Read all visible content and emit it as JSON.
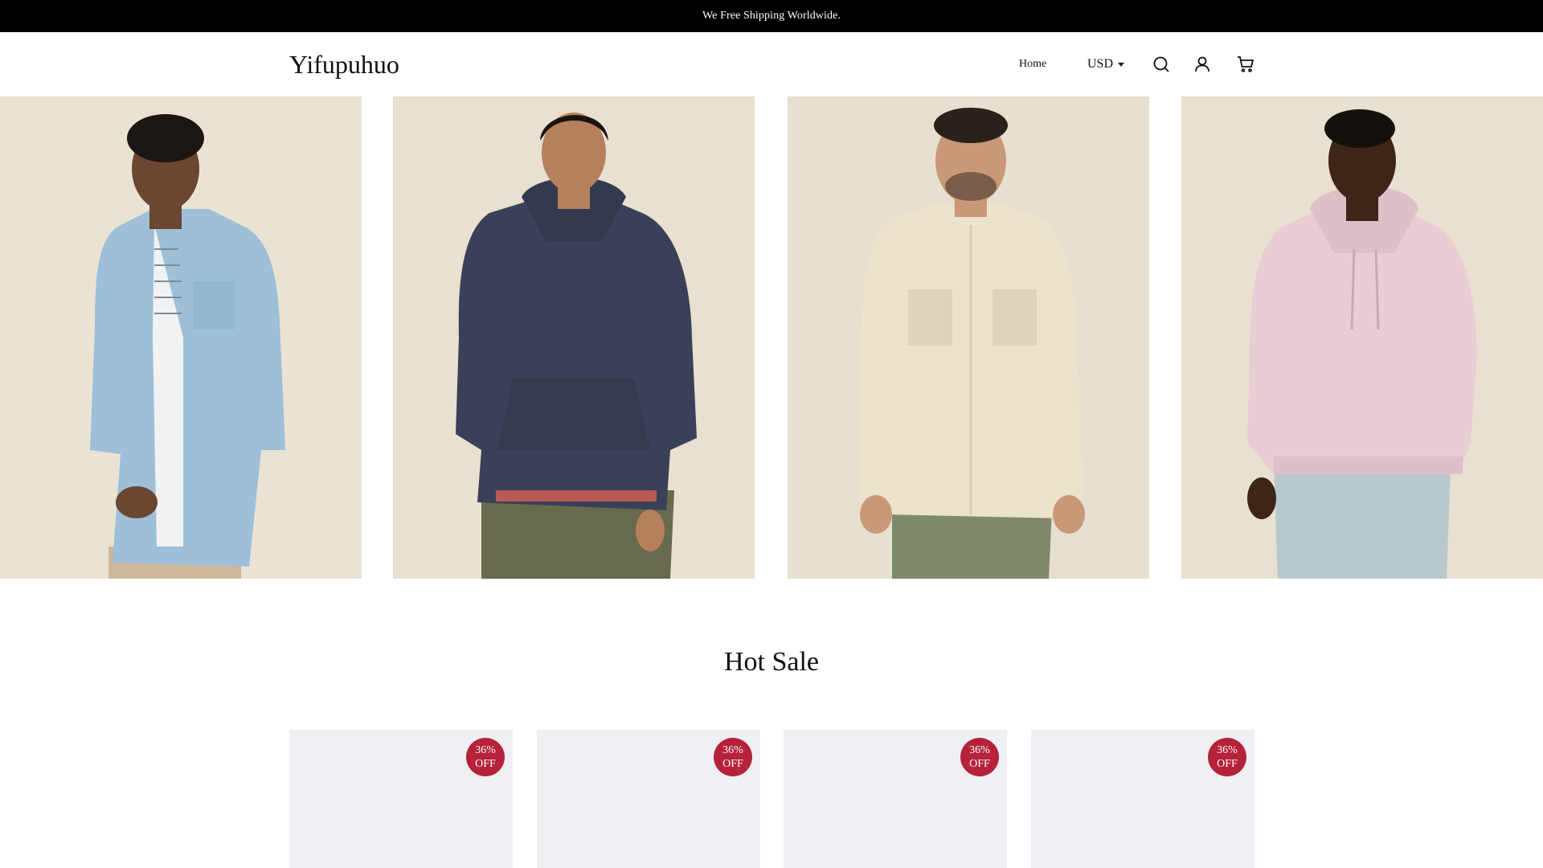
{
  "announcement": {
    "text": "We Free Shipping Worldwide."
  },
  "header": {
    "logo": "Yifupuhuo",
    "nav": {
      "home": "Home"
    },
    "currency": {
      "selected": "USD"
    },
    "icons": [
      "search-icon",
      "account-icon",
      "cart-icon"
    ]
  },
  "hero": {
    "panels": [
      {
        "subject": "model-denim-shirt",
        "colors": {
          "garment": "#9dbfd8",
          "pants": "#cfb79c"
        }
      },
      {
        "subject": "model-navy-hoodie",
        "colors": {
          "garment": "#3a4057",
          "pants": "#676a4c"
        }
      },
      {
        "subject": "model-cream-shirt",
        "colors": {
          "garment": "#ebe3cc",
          "pants": "#7f8a6c"
        }
      },
      {
        "subject": "model-pink-hoodie",
        "colors": {
          "garment": "#e8cdd5",
          "pants": "#b9c8cd"
        }
      }
    ],
    "background": "#e8e0d0"
  },
  "hot_sale": {
    "title": "Hot Sale",
    "products": [
      {
        "badge_top": "36%",
        "badge_bottom": "OFF"
      },
      {
        "badge_top": "36%",
        "badge_bottom": "OFF"
      },
      {
        "badge_top": "36%",
        "badge_bottom": "OFF"
      },
      {
        "badge_top": "36%",
        "badge_bottom": "OFF"
      }
    ],
    "badge_color": "#b52239",
    "card_color": "#eff0f4"
  }
}
